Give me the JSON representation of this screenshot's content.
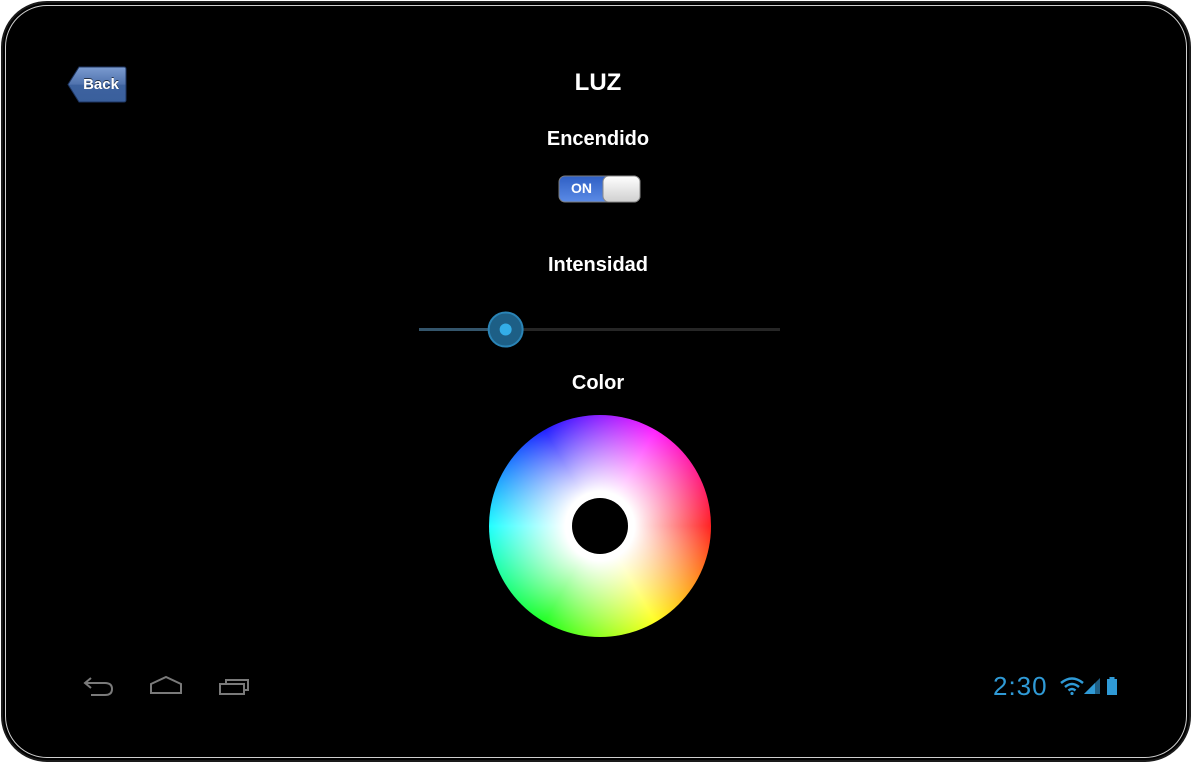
{
  "header": {
    "back_label": "Back",
    "title": "LUZ"
  },
  "power": {
    "label": "Encendido",
    "toggle_text": "ON",
    "state": true
  },
  "intensity": {
    "label": "Intensidad",
    "value_fraction": 0.24
  },
  "color": {
    "label": "Color"
  },
  "statusbar": {
    "time": "2:30"
  },
  "colors": {
    "accent": "#2f9ad6",
    "toggle_on": "#3a6fd0",
    "back_button": "#4a6fa5"
  },
  "icons": {
    "nav_back": "back-arrow-icon",
    "nav_home": "home-icon",
    "nav_recents": "recent-apps-icon",
    "wifi": "wifi-icon",
    "signal": "signal-icon",
    "battery": "battery-icon"
  }
}
